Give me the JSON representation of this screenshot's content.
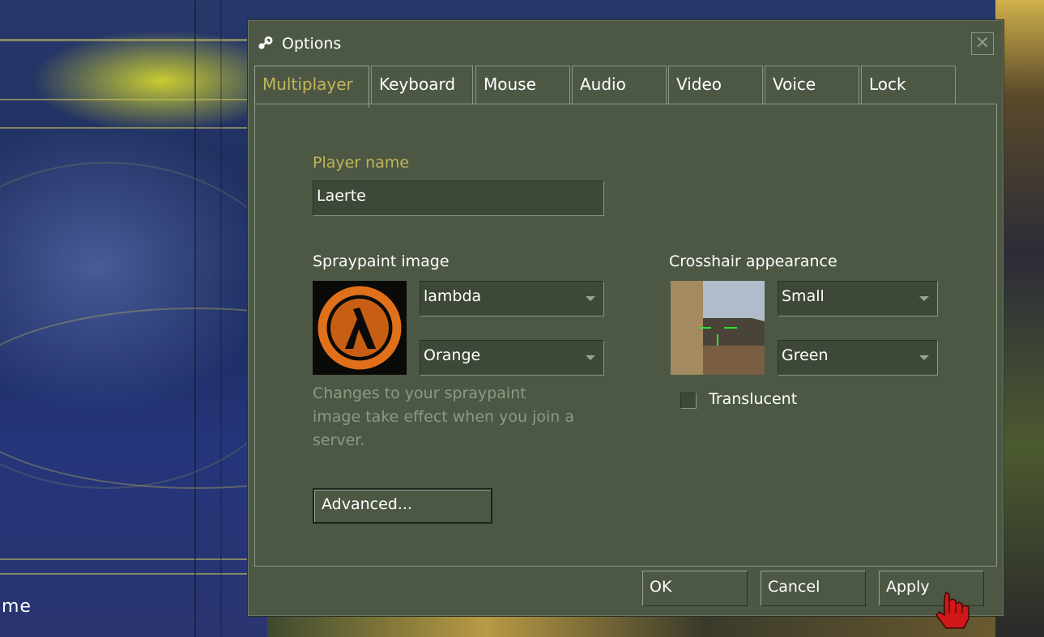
{
  "background": {
    "partial_text": "me"
  },
  "window": {
    "title": "Options",
    "close_glyph": "✕"
  },
  "tabs": [
    {
      "label": "Multiplayer",
      "active": true
    },
    {
      "label": "Keyboard"
    },
    {
      "label": "Mouse"
    },
    {
      "label": "Audio"
    },
    {
      "label": "Video"
    },
    {
      "label": "Voice"
    },
    {
      "label": "Lock"
    }
  ],
  "multiplayer": {
    "player_name_label": "Player name",
    "player_name_value": "Laerte",
    "spraypaint": {
      "label": "Spraypaint image",
      "image_value": "lambda",
      "color_value": "Orange",
      "note": "Changes to your spraypaint image take effect when you join a server.",
      "note_lines": [
        "Changes to your spraypaint",
        "image take effect when you join a",
        "server."
      ]
    },
    "crosshair": {
      "label": "Crosshair appearance",
      "size_value": "Small",
      "color_value": "Green",
      "translucent_label": "Translucent",
      "translucent_checked": false
    },
    "advanced_button": "Advanced..."
  },
  "buttons": {
    "ok": "OK",
    "cancel": "Cancel",
    "apply": "Apply"
  },
  "colors": {
    "panel_bg": "#4c5844",
    "accent_gold": "#c4b45a",
    "spray_orange": "#e0701a",
    "crosshair_green": "#2ee02e"
  },
  "icons": {
    "title": "steam-icon",
    "cursor": "hand-cursor-icon"
  }
}
